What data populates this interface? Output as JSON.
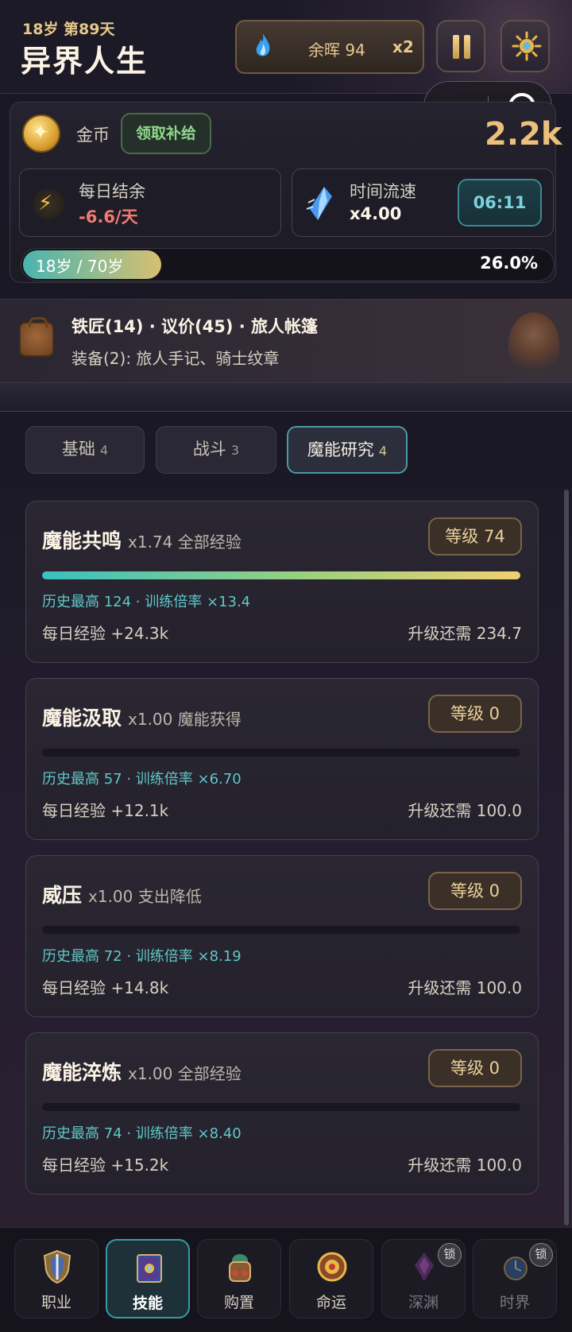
{
  "header": {
    "age_day": "18岁 第89天",
    "title": "异界人生",
    "ember_label": "余晖 94",
    "ember_mult": "x2"
  },
  "panel": {
    "gold_label": "金币",
    "claim_label": "领取补给",
    "gold_amount": "2.2k",
    "daily_balance_label": "每日结余",
    "daily_balance_value": "-6.6/天",
    "time_flow_label": "时间流速",
    "time_flow_value": "x4.00",
    "clock": "06:11",
    "life_label": "18岁 / 70岁",
    "life_pct_text": "26.0%",
    "life_progress": 0.26
  },
  "info": {
    "line1": "铁匠(14) · 议价(45) · 旅人帐篷",
    "line2": "装备(2): 旅人手记、骑士纹章"
  },
  "tabs": [
    {
      "label": "基础",
      "count": "4"
    },
    {
      "label": "战斗",
      "count": "3"
    },
    {
      "label": "魔能研究",
      "count": "4"
    }
  ],
  "skills": [
    {
      "name": "魔能共鸣",
      "mult": "x1.74 全部经验",
      "level": "等级 74",
      "progress": 1.0,
      "history": "历史最高 124 · 训练倍率 ×13.4",
      "daily": "每日经验 +24.3k",
      "need": "升级还需 234.7"
    },
    {
      "name": "魔能汲取",
      "mult": "x1.00 魔能获得",
      "level": "等级 0",
      "progress": 0.0,
      "history": "历史最高 57 · 训练倍率 ×6.70",
      "daily": "每日经验 +12.1k",
      "need": "升级还需 100.0"
    },
    {
      "name": "威压",
      "mult": "x1.00 支出降低",
      "level": "等级 0",
      "progress": 0.0,
      "history": "历史最高 72 · 训练倍率 ×8.19",
      "daily": "每日经验 +14.8k",
      "need": "升级还需 100.0"
    },
    {
      "name": "魔能淬炼",
      "mult": "x1.00 全部经验",
      "level": "等级 0",
      "progress": 0.0,
      "history": "历史最高 74 · 训练倍率 ×8.40",
      "daily": "每日经验 +15.2k",
      "need": "升级还需 100.0"
    }
  ],
  "nav": [
    {
      "label": "职业",
      "icon": "shield-sword-icon"
    },
    {
      "label": "技能",
      "icon": "spellbook-icon"
    },
    {
      "label": "购置",
      "icon": "backpack-icon"
    },
    {
      "label": "命运",
      "icon": "fate-medallion-icon"
    },
    {
      "label": "深渊",
      "icon": "abyss-crystal-icon",
      "lock": "锁"
    },
    {
      "label": "时界",
      "icon": "time-realm-icon",
      "lock": "锁"
    }
  ]
}
